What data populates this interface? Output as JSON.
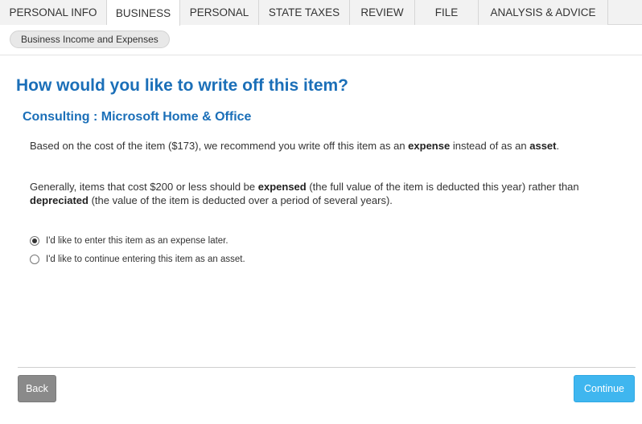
{
  "tabs": [
    {
      "label": "PERSONAL INFO"
    },
    {
      "label": "BUSINESS"
    },
    {
      "label": "PERSONAL"
    },
    {
      "label": "STATE TAXES"
    },
    {
      "label": "REVIEW"
    },
    {
      "label": "FILE"
    },
    {
      "label": "ANALYSIS & ADVICE"
    }
  ],
  "active_tab": "BUSINESS",
  "subnav": {
    "pill_label": "Business Income and Expenses"
  },
  "main": {
    "title": "How would you like to write off this item?",
    "item_title": "Consulting : Microsoft Home & Office",
    "para1": {
      "t1": "Based on the cost of the item ($173), we recommend you write off this item as an ",
      "b1": "expense",
      "t2": " instead of as an ",
      "b2": "asset",
      "t3": "."
    },
    "para2": {
      "t1": "Generally, items that cost $200 or less should be ",
      "b1": "expensed",
      "t2": " (the full value of the item is deducted this year) rather than ",
      "b2": "depreciated",
      "t3": " (the value of the item is deducted over a period of several years)."
    },
    "options": [
      {
        "label": "I'd like to enter this item as an expense later.",
        "checked": true
      },
      {
        "label": "I'd like to continue entering this item as an asset.",
        "checked": false
      }
    ]
  },
  "footer": {
    "back_label": "Back",
    "continue_label": "Continue"
  },
  "colors": {
    "accent_blue": "#1b6fb8",
    "continue_button": "#3fb6ef",
    "back_button": "#8a8a8a"
  }
}
